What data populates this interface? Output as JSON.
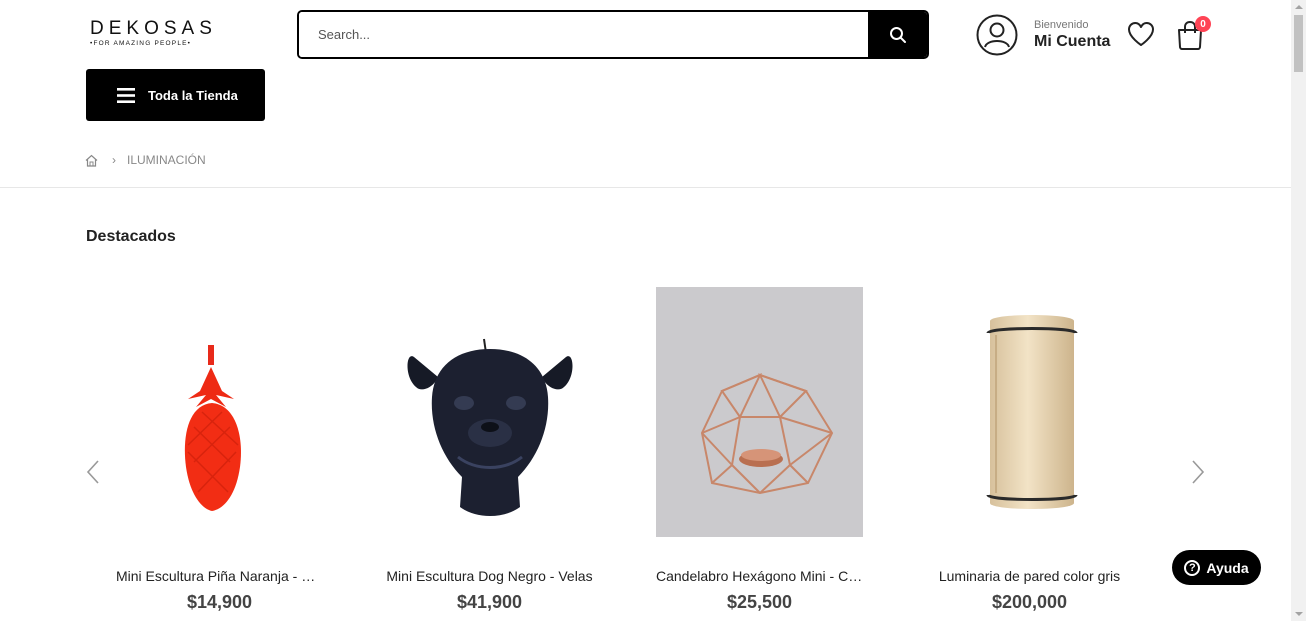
{
  "header": {
    "logo_main": "DEKOSAS",
    "logo_sub": "•FOR AMAZING PEOPLE•",
    "search_placeholder": "Search...",
    "account_welcome": "Bienvenido",
    "account_name": "Mi Cuenta",
    "cart_count": "0"
  },
  "nav": {
    "store_button_label": "Toda la Tienda"
  },
  "breadcrumb": {
    "current": "ILUMINACIÓN"
  },
  "section": {
    "title": "Destacados"
  },
  "products": [
    {
      "name": "Mini Escultura Piña Naranja - Velas",
      "price": "$14,900"
    },
    {
      "name": "Mini Escultura Dog Negro - Velas",
      "price": "$41,900"
    },
    {
      "name": "Candelabro Hexágono Mini - Cobre",
      "price": "$25,500"
    },
    {
      "name": "Luminaria de pared color gris",
      "price": "$200,000"
    }
  ],
  "help": {
    "label": "Ayuda"
  },
  "colors": {
    "primary": "#000000",
    "badge": "#ff4455"
  }
}
